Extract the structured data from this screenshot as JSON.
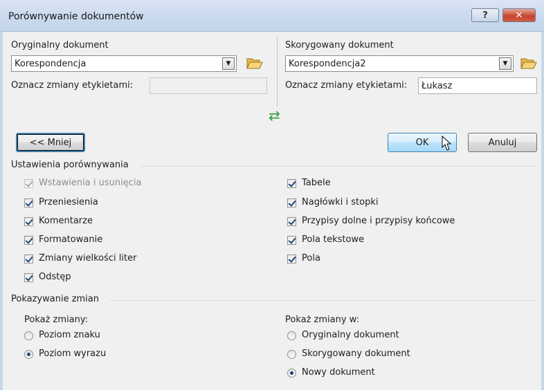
{
  "window": {
    "title": "Porównywanie dokumentów",
    "help_label": "?",
    "close_label": "✕"
  },
  "original": {
    "label": "Oryginalny dokument",
    "value": "Korespondencja",
    "tag_label": "Oznacz zmiany etykietami:",
    "tag_value": ""
  },
  "revised": {
    "label": "Skorygowany dokument",
    "value": "Korespondencja2",
    "tag_label": "Oznacz zmiany etykietami:",
    "tag_value": "Łukasz"
  },
  "swap_icon": "⇄",
  "buttons": {
    "less": "<< Mniej",
    "ok": "OK",
    "cancel": "Anuluj"
  },
  "comparison_settings": {
    "title": "Ustawienia porównywania",
    "left": [
      {
        "label": "Wstawienia i usunięcia",
        "checked": true,
        "disabled": true
      },
      {
        "label": "Przeniesienia",
        "checked": true,
        "disabled": false
      },
      {
        "label": "Komentarze",
        "checked": true,
        "disabled": false
      },
      {
        "label": "Formatowanie",
        "checked": true,
        "disabled": false
      },
      {
        "label": "Zmiany wielkości liter",
        "checked": true,
        "disabled": false
      },
      {
        "label": "Odstęp",
        "checked": true,
        "disabled": false
      }
    ],
    "right": [
      {
        "label": "Tabele",
        "checked": true
      },
      {
        "label": "Nagłówki i stopki",
        "checked": true
      },
      {
        "label": "Przypisy dolne i przypisy końcowe",
        "checked": true
      },
      {
        "label": "Pola tekstowe",
        "checked": true
      },
      {
        "label": "Pola",
        "checked": true
      }
    ]
  },
  "show_changes": {
    "title": "Pokazywanie zmian",
    "level_label": "Pokaż zmiany:",
    "level_options": [
      {
        "label": "Poziom znaku",
        "selected": false
      },
      {
        "label": "Poziom wyrazu",
        "selected": true
      }
    ],
    "in_label": "Pokaż zmiany w:",
    "in_options": [
      {
        "label": "Oryginalny dokument",
        "selected": false
      },
      {
        "label": "Skorygowany dokument",
        "selected": false
      },
      {
        "label": "Nowy dokument",
        "selected": true
      }
    ]
  },
  "colors": {
    "accent": "#3c7fb1",
    "titlebar": "#cbdaee",
    "close": "#c7452f",
    "swap_arrows": "#2e9a3a"
  }
}
